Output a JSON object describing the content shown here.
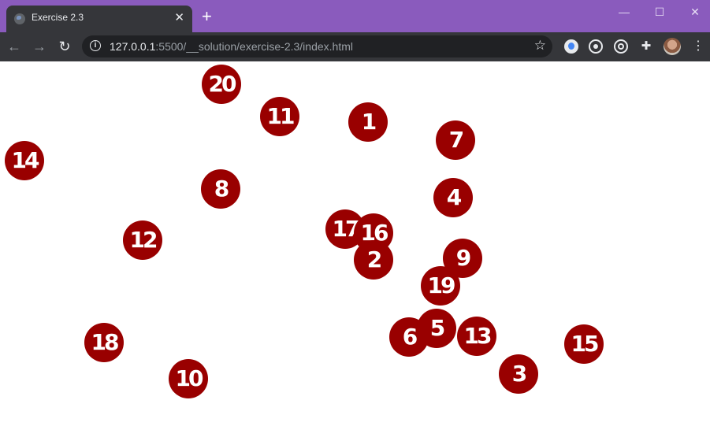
{
  "browser": {
    "tab_title": "Exercise 2.3",
    "tab_close": "✕",
    "new_tab": "+",
    "window_min": "—",
    "window_max": "☐",
    "window_close": "✕",
    "url_host": "127.0.0.1",
    "url_rest": ":5500/__solution/exercise-2.3/index.html",
    "back_icon": "←",
    "forward_icon": "→",
    "reload_icon": "↻",
    "star_icon": "☆",
    "extensions_icon": "✚",
    "menu_icon": "⋮"
  },
  "page": {
    "ball_color": "#990000",
    "balls": [
      "1",
      "2",
      "3",
      "4",
      "5",
      "6",
      "7",
      "8",
      "9",
      "10",
      "11",
      "12",
      "13",
      "14",
      "15",
      "16",
      "17",
      "18",
      "19",
      "20"
    ]
  }
}
